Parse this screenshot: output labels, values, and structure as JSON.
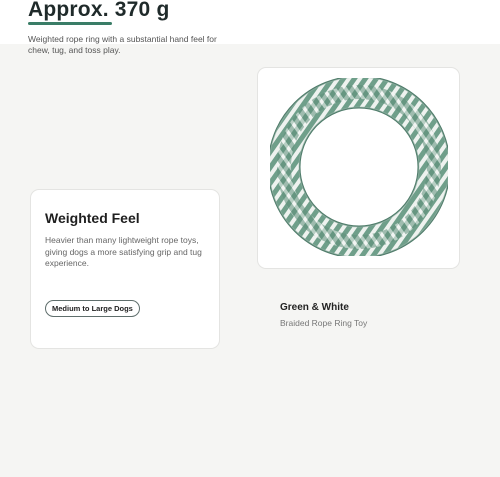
{
  "header": {
    "title": "Approx. 370 g",
    "intro": "Weighted rope ring with a substantial hand feel for chew, tug, and toss play.",
    "accent_color": "#3a7d67"
  },
  "feature": {
    "title": "Weighted Feel",
    "description": "Heavier than many lightweight rope toys, giving dogs a more satisfying grip and tug experience.",
    "badge": "Medium to Large Dogs"
  },
  "product": {
    "image_icon": "rope-ring-toy-image",
    "color_name": "Green & White",
    "type": "Braided Rope Ring Toy",
    "rope_colors": [
      "#6f9f8a",
      "#f2f4f2"
    ]
  }
}
